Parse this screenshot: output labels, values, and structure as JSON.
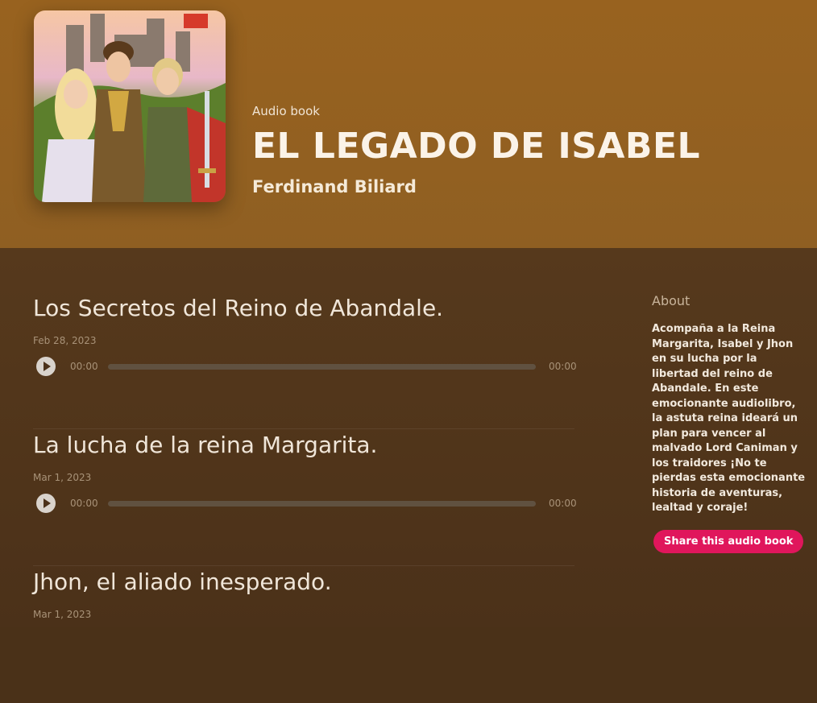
{
  "header": {
    "kicker": "Audio book",
    "title": "EL LEGADO DE ISABEL",
    "author": "Ferdinand Biliard"
  },
  "episodes": [
    {
      "title": "Los Secretos del Reino de Abandale.",
      "date": "Feb 28, 2023",
      "current_time": "00:00",
      "duration": "00:00",
      "progress": 0
    },
    {
      "title": "La lucha de la reina Margarita.",
      "date": "Mar 1, 2023",
      "current_time": "00:00",
      "duration": "00:00",
      "progress": 0
    },
    {
      "title": "Jhon, el aliado inesperado.",
      "date": "Mar 1, 2023"
    }
  ],
  "about": {
    "heading": "About",
    "text": "Acompaña a la Reina Margarita, Isabel y Jhon en su lucha por la libertad del reino de Abandale. En este emocionante audiolibro, la astuta reina ideará un plan para vencer al malvado Lord Caniman y los traidores ¡No te pierdas esta emocionante historia de aventuras, lealtad y coraje!",
    "share_label": "Share this audio book"
  },
  "colors": {
    "header_bg": "#98621f",
    "body_bg": "#4b3119",
    "share_button": "#e0165c"
  },
  "icons": [
    "play-icon"
  ]
}
